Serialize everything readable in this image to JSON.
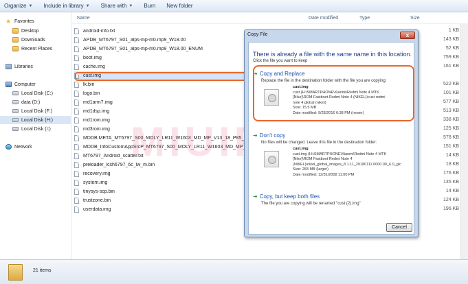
{
  "toolbar": {
    "buttons": [
      {
        "label": "Organize",
        "dropdown": true
      },
      {
        "label": "Include in library",
        "dropdown": true
      },
      {
        "label": "Share with",
        "dropdown": true
      },
      {
        "label": "Burn",
        "dropdown": false
      },
      {
        "label": "New folder",
        "dropdown": false
      }
    ]
  },
  "nav": {
    "items": [
      {
        "label": "Favorites",
        "icon": "star-icon"
      },
      {
        "label": "Desktop",
        "icon": "folder-icon"
      },
      {
        "label": "Downloads",
        "icon": "folder-icon"
      },
      {
        "label": "Recent Places",
        "icon": "folder-icon"
      },
      {
        "label": "Libraries",
        "icon": "library-icon"
      },
      {
        "label": "Computer",
        "icon": "computer-icon"
      },
      {
        "label": "Local Disk (C:)",
        "icon": "drive-icon"
      },
      {
        "label": "data (D:)",
        "icon": "drive-icon"
      },
      {
        "label": "Local Disk (F:)",
        "icon": "drive-icon"
      },
      {
        "label": "Local Disk (H:)",
        "icon": "drive-icon",
        "selected": true
      },
      {
        "label": "Local Disk (I:)",
        "icon": "drive-icon"
      },
      {
        "label": "Network",
        "icon": "network-icon"
      }
    ]
  },
  "columns": {
    "name": "Name",
    "date": "Date modified",
    "type": "Type",
    "size": "Size"
  },
  "files": [
    {
      "name": "android-info.txt",
      "size": "1 KB"
    },
    {
      "name": "APDB_MT6797_S01_alps-mp-m0.mp9_W18.00",
      "size": "143 KB"
    },
    {
      "name": "APDB_MT6797_S01_alps-mp-m0.mp9_W18.00_ENUM",
      "size": "52 KB"
    },
    {
      "name": "boot.img",
      "size": "759 KB"
    },
    {
      "name": "cache.img",
      "size": "161 KB"
    },
    {
      "name": "cust.img",
      "size": "",
      "highlight": true
    },
    {
      "name": "lk.bin",
      "size": "522 KB"
    },
    {
      "name": "logo.bin",
      "size": "101 KB"
    },
    {
      "name": "md1arm7.img",
      "size": "577 KB"
    },
    {
      "name": "md1dsp.img",
      "size": "513 KB"
    },
    {
      "name": "md1rom.img",
      "size": "338 KB"
    },
    {
      "name": "md3rom.img",
      "size": "125 KB"
    },
    {
      "name": "MDDB.META_MT6797_S00_MOLY_LR11_W1603_MD_MP_V13_18_P85_1_...",
      "size": "578 KB"
    },
    {
      "name": "MDDB_InfoCustomAppSrcP_MT6797_S00_MOLY_LR11_W1603_MD_MP_V13...",
      "size": "151 KB"
    },
    {
      "name": "MT6797_Android_scatter.txt",
      "size": "14 KB"
    },
    {
      "name": "preloader_lcsh6797_6c_lw_m.bin",
      "size": "18 KB"
    },
    {
      "name": "recovery.img",
      "size": "176 KB"
    },
    {
      "name": "system.img",
      "size": "135 KB"
    },
    {
      "name": "tinysys-scp.bin",
      "size": "14 KB"
    },
    {
      "name": "trustzone.bin",
      "size": "124 KB"
    },
    {
      "name": "userdata.img",
      "size": "196 KB"
    }
  ],
  "watermark": "MIUIPEDIA",
  "dialog": {
    "title": "Copy File",
    "close_label": "x",
    "heading": "There is already a file with the same name in this location.",
    "subheading": "Click the file you want to keep",
    "options": [
      {
        "title": "Copy and Replace",
        "desc": "Replace the file in the destination folder with the file you are copying:",
        "file_name": "cust.img",
        "lines": [
          "cust (H:\\SMARTPHONE\\Xiaomi\\Redmi Note 4 MTK",
          "[Nike]\\ROM Fastboot Redmi Note 4 (NIKEL)\\cust redmi",
          "note 4 global (nike))",
          "Size: 15.5 MB",
          "Date modified: 9/28/2016 6:38 PM (newer)"
        ]
      },
      {
        "title": "Don't copy",
        "desc": "No files will be changed. Leave this file in the destination folder:",
        "file_name": "cust.img",
        "lines": [
          "cust.img (H:\\SMARTPHONE\\Xiaomi\\Redmi Note 4 MTK",
          "[Nike]\\ROM Fastboot Redmi Note 4",
          "(NIKEL)\\nikel_global_images_8.1.11_20180111.0000.00_6.0_glc",
          "Size: 283 MB (larger)",
          "Date modified: 12/31/2008 11:00 PM"
        ]
      },
      {
        "title": "Copy, but keep both files",
        "desc": "The file you are copying will be renamed \"cust (2).img\""
      }
    ],
    "cancel_label": "Cancel"
  },
  "status": {
    "count": "21 items"
  },
  "colors": {
    "accent_frame": "#e8672a",
    "link_blue": "#1b4fb1",
    "selection": "#d3e5fa"
  }
}
